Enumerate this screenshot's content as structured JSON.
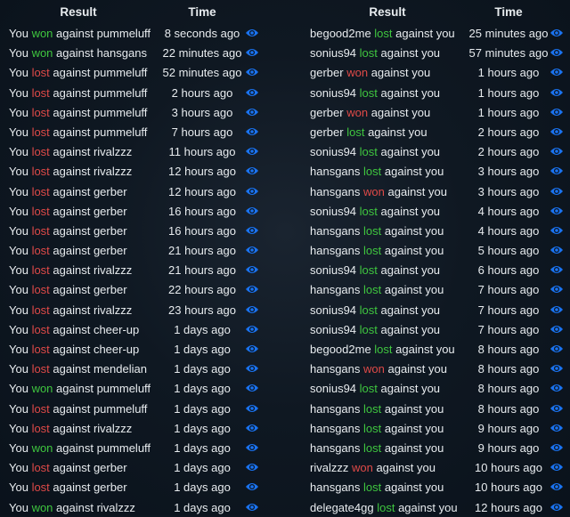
{
  "colors": {
    "good": "#3fc63f",
    "bad": "#e04a48",
    "eye": "#1a73f0"
  },
  "left": {
    "header": {
      "result": "Result",
      "time": "Time"
    },
    "rows": [
      {
        "pre": "You",
        "verb": "won",
        "post": "against pummeluff",
        "outcome": "good",
        "time": "8 seconds ago"
      },
      {
        "pre": "You",
        "verb": "won",
        "post": "against hansgans",
        "outcome": "good",
        "time": "22 minutes ago"
      },
      {
        "pre": "You",
        "verb": "lost",
        "post": "against pummeluff",
        "outcome": "bad",
        "time": "52 minutes ago"
      },
      {
        "pre": "You",
        "verb": "lost",
        "post": "against pummeluff",
        "outcome": "bad",
        "time": "2 hours ago"
      },
      {
        "pre": "You",
        "verb": "lost",
        "post": "against pummeluff",
        "outcome": "bad",
        "time": "3 hours ago"
      },
      {
        "pre": "You",
        "verb": "lost",
        "post": "against pummeluff",
        "outcome": "bad",
        "time": "7 hours ago"
      },
      {
        "pre": "You",
        "verb": "lost",
        "post": "against rivalzzz",
        "outcome": "bad",
        "time": "11 hours ago"
      },
      {
        "pre": "You",
        "verb": "lost",
        "post": "against rivalzzz",
        "outcome": "bad",
        "time": "12 hours ago"
      },
      {
        "pre": "You",
        "verb": "lost",
        "post": "against gerber",
        "outcome": "bad",
        "time": "12 hours ago"
      },
      {
        "pre": "You",
        "verb": "lost",
        "post": "against gerber",
        "outcome": "bad",
        "time": "16 hours ago"
      },
      {
        "pre": "You",
        "verb": "lost",
        "post": "against gerber",
        "outcome": "bad",
        "time": "16 hours ago"
      },
      {
        "pre": "You",
        "verb": "lost",
        "post": "against gerber",
        "outcome": "bad",
        "time": "21 hours ago"
      },
      {
        "pre": "You",
        "verb": "lost",
        "post": "against rivalzzz",
        "outcome": "bad",
        "time": "21 hours ago"
      },
      {
        "pre": "You",
        "verb": "lost",
        "post": "against gerber",
        "outcome": "bad",
        "time": "22 hours ago"
      },
      {
        "pre": "You",
        "verb": "lost",
        "post": "against rivalzzz",
        "outcome": "bad",
        "time": "23 hours ago"
      },
      {
        "pre": "You",
        "verb": "lost",
        "post": "against cheer-up",
        "outcome": "bad",
        "time": "1 days ago"
      },
      {
        "pre": "You",
        "verb": "lost",
        "post": "against cheer-up",
        "outcome": "bad",
        "time": "1 days ago"
      },
      {
        "pre": "You",
        "verb": "lost",
        "post": "against mendelian",
        "outcome": "bad",
        "time": "1 days ago"
      },
      {
        "pre": "You",
        "verb": "won",
        "post": "against pummeluff",
        "outcome": "good",
        "time": "1 days ago"
      },
      {
        "pre": "You",
        "verb": "lost",
        "post": "against pummeluff",
        "outcome": "bad",
        "time": "1 days ago"
      },
      {
        "pre": "You",
        "verb": "lost",
        "post": "against rivalzzz",
        "outcome": "bad",
        "time": "1 days ago"
      },
      {
        "pre": "You",
        "verb": "won",
        "post": "against pummeluff",
        "outcome": "good",
        "time": "1 days ago"
      },
      {
        "pre": "You",
        "verb": "lost",
        "post": "against gerber",
        "outcome": "bad",
        "time": "1 days ago"
      },
      {
        "pre": "You",
        "verb": "lost",
        "post": "against gerber",
        "outcome": "bad",
        "time": "1 days ago"
      },
      {
        "pre": "You",
        "verb": "won",
        "post": "against rivalzzz",
        "outcome": "good",
        "time": "1 days ago"
      }
    ]
  },
  "right": {
    "header": {
      "result": "Result",
      "time": "Time"
    },
    "rows": [
      {
        "pre": "begood2me",
        "verb": "lost",
        "post": "against you",
        "outcome": "good",
        "time": "25 minutes ago"
      },
      {
        "pre": "sonius94",
        "verb": "lost",
        "post": "against you",
        "outcome": "good",
        "time": "57 minutes ago"
      },
      {
        "pre": "gerber",
        "verb": "won",
        "post": "against you",
        "outcome": "bad",
        "time": "1 hours ago"
      },
      {
        "pre": "sonius94",
        "verb": "lost",
        "post": "against you",
        "outcome": "good",
        "time": "1 hours ago"
      },
      {
        "pre": "gerber",
        "verb": "won",
        "post": "against you",
        "outcome": "bad",
        "time": "1 hours ago"
      },
      {
        "pre": "gerber",
        "verb": "lost",
        "post": "against you",
        "outcome": "good",
        "time": "2 hours ago"
      },
      {
        "pre": "sonius94",
        "verb": "lost",
        "post": "against you",
        "outcome": "good",
        "time": "2 hours ago"
      },
      {
        "pre": "hansgans",
        "verb": "lost",
        "post": "against you",
        "outcome": "good",
        "time": "3 hours ago"
      },
      {
        "pre": "hansgans",
        "verb": "won",
        "post": "against you",
        "outcome": "bad",
        "time": "3 hours ago"
      },
      {
        "pre": "sonius94",
        "verb": "lost",
        "post": "against you",
        "outcome": "good",
        "time": "4 hours ago"
      },
      {
        "pre": "hansgans",
        "verb": "lost",
        "post": "against you",
        "outcome": "good",
        "time": "4 hours ago"
      },
      {
        "pre": "hansgans",
        "verb": "lost",
        "post": "against you",
        "outcome": "good",
        "time": "5 hours ago"
      },
      {
        "pre": "sonius94",
        "verb": "lost",
        "post": "against you",
        "outcome": "good",
        "time": "6 hours ago"
      },
      {
        "pre": "hansgans",
        "verb": "lost",
        "post": "against you",
        "outcome": "good",
        "time": "7 hours ago"
      },
      {
        "pre": "sonius94",
        "verb": "lost",
        "post": "against you",
        "outcome": "good",
        "time": "7 hours ago"
      },
      {
        "pre": "sonius94",
        "verb": "lost",
        "post": "against you",
        "outcome": "good",
        "time": "7 hours ago"
      },
      {
        "pre": "begood2me",
        "verb": "lost",
        "post": "against you",
        "outcome": "good",
        "time": "8 hours ago"
      },
      {
        "pre": "hansgans",
        "verb": "won",
        "post": "against you",
        "outcome": "bad",
        "time": "8 hours ago"
      },
      {
        "pre": "sonius94",
        "verb": "lost",
        "post": "against you",
        "outcome": "good",
        "time": "8 hours ago"
      },
      {
        "pre": "hansgans",
        "verb": "lost",
        "post": "against you",
        "outcome": "good",
        "time": "8 hours ago"
      },
      {
        "pre": "hansgans",
        "verb": "lost",
        "post": "against you",
        "outcome": "good",
        "time": "9 hours ago"
      },
      {
        "pre": "hansgans",
        "verb": "lost",
        "post": "against you",
        "outcome": "good",
        "time": "9 hours ago"
      },
      {
        "pre": "rivalzzz",
        "verb": "won",
        "post": "against you",
        "outcome": "bad",
        "time": "10 hours ago"
      },
      {
        "pre": "hansgans",
        "verb": "lost",
        "post": "against you",
        "outcome": "good",
        "time": "10 hours ago"
      },
      {
        "pre": "delegate4gg",
        "verb": "lost",
        "post": "against you",
        "outcome": "good",
        "time": "12 hours ago"
      }
    ]
  }
}
